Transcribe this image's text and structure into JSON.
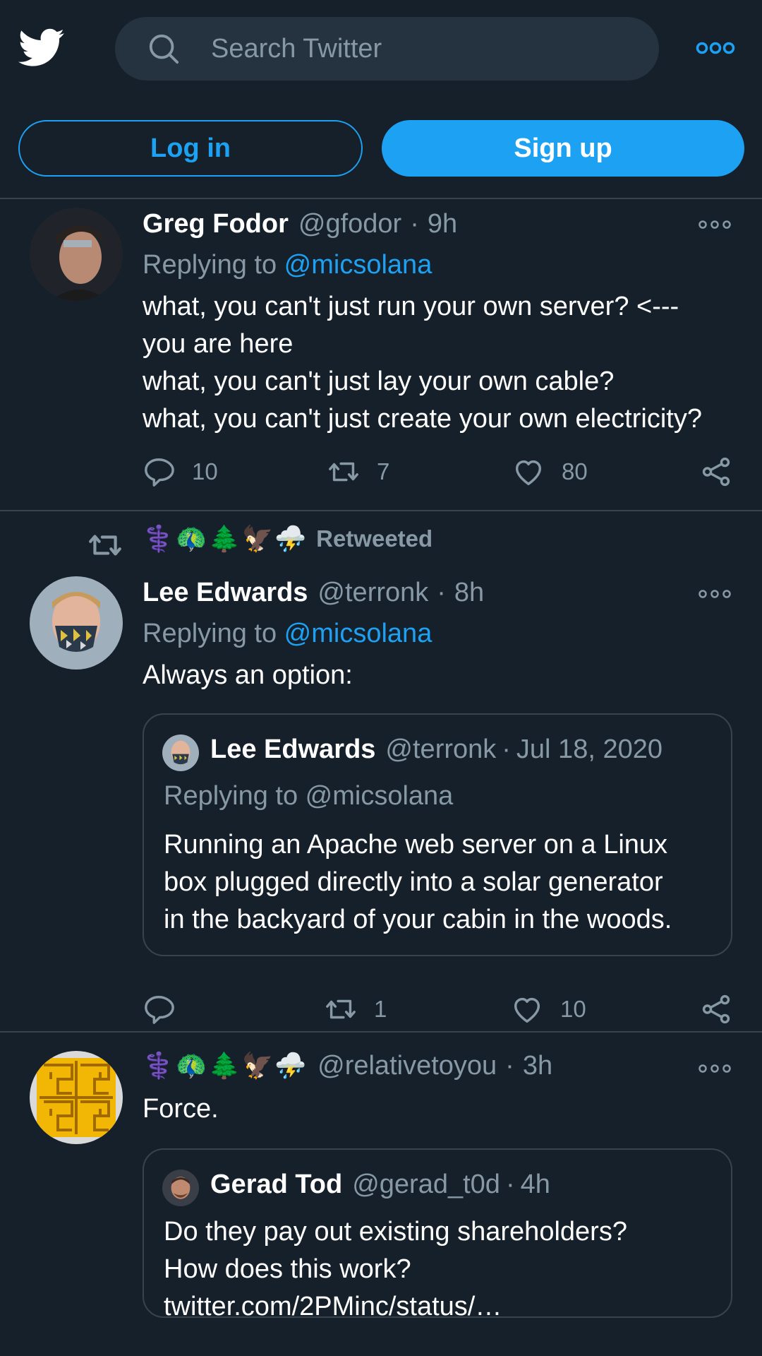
{
  "header": {
    "search_placeholder": "Search Twitter",
    "login_label": "Log in",
    "signup_label": "Sign up"
  },
  "colors": {
    "background": "#15202b",
    "accent": "#1da1f2",
    "muted": "#8899a6",
    "border": "#38444d"
  },
  "tweets": [
    {
      "name": "Greg Fodor",
      "handle": "@gfodor",
      "time": "9h",
      "replying_prefix": "Replying to ",
      "replying_to": "@micsolana",
      "lines": [
        "what, you can't just run your own server? <---",
        "you are here",
        "what, you can't just lay your own cable?",
        "what, you can't just create your own electricity?"
      ],
      "replies": "10",
      "retweets": "7",
      "likes": "80"
    },
    {
      "retweeted_by_emoji": "⚕️🦚🌲🦅⛈️",
      "retweeted_label": "Retweeted",
      "name": "Lee Edwards",
      "handle": "@terronk",
      "time": "8h",
      "replying_prefix": "Replying to ",
      "replying_to": "@micsolana",
      "text": "Always an option:",
      "quote": {
        "name": "Lee Edwards",
        "handle": "@terronk",
        "date": "Jul 18, 2020",
        "replying": "Replying to @micsolana",
        "lines": [
          "Running an Apache web server on a Linux",
          "box plugged directly into a solar generator",
          "in the backyard of your cabin in the woods."
        ]
      },
      "replies": "",
      "retweets": "1",
      "likes": "10"
    },
    {
      "name_emoji": "⚕️🦚🌲🦅⛈️",
      "handle": "@relativetoyou",
      "time": "3h",
      "text": "Force.",
      "quote": {
        "name": "Gerad Tod",
        "handle": "@gerad_t0d",
        "date": "4h",
        "lines": [
          "Do they pay out existing shareholders?",
          "How does this work?",
          "twitter.com/2PMinc/status/…"
        ]
      }
    }
  ]
}
